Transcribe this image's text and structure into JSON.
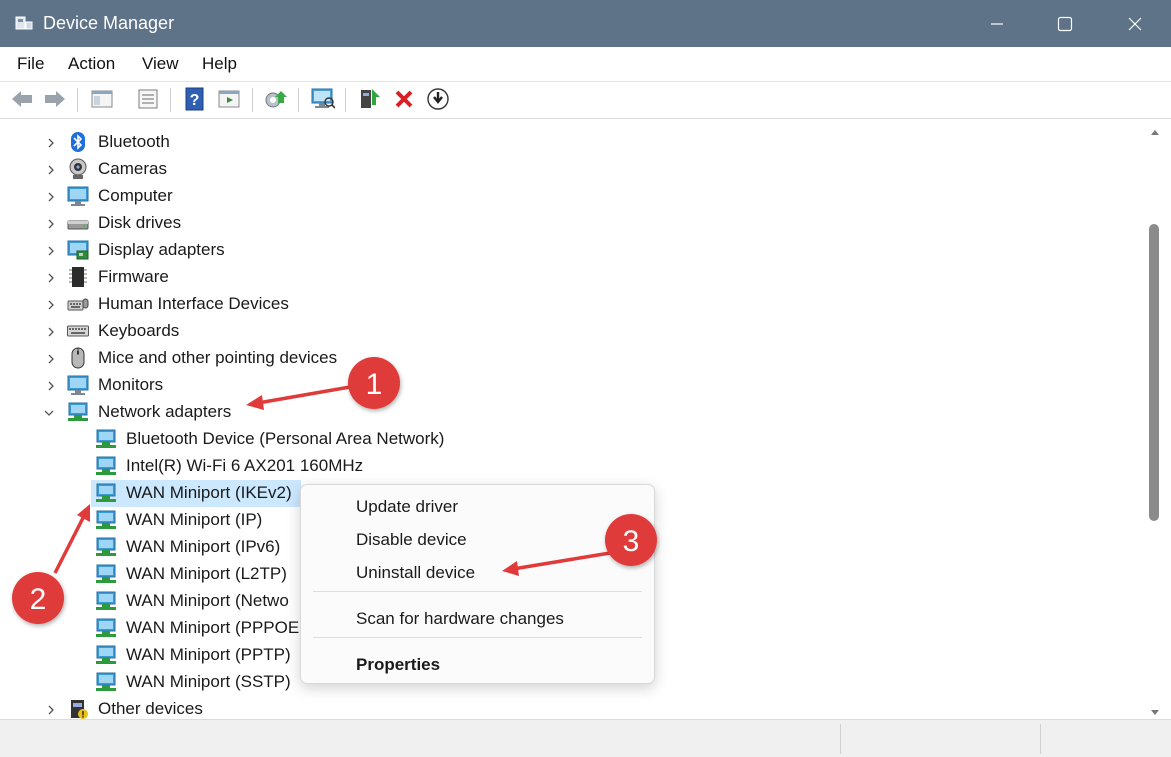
{
  "window": {
    "title": "Device Manager"
  },
  "menu": [
    "File",
    "Action",
    "View",
    "Help"
  ],
  "toolbar": {
    "buttons": [
      "back-icon",
      "forward-icon",
      "show-hide-console-tree-icon",
      "properties-icon",
      "help-icon",
      "action-pane-icon",
      "update-driver-icon",
      "scan-hardware-icon",
      "enable-device-icon",
      "uninstall-device-icon",
      "disable-device-icon"
    ]
  },
  "tree": {
    "categories": [
      {
        "label": "Bluetooth",
        "icon": "bluetooth-icon"
      },
      {
        "label": "Cameras",
        "icon": "camera-icon"
      },
      {
        "label": "Computer",
        "icon": "computer-icon"
      },
      {
        "label": "Disk drives",
        "icon": "disk-drive-icon"
      },
      {
        "label": "Display adapters",
        "icon": "display-adapter-icon"
      },
      {
        "label": "Firmware",
        "icon": "firmware-icon"
      },
      {
        "label": "Human Interface Devices",
        "icon": "hid-icon"
      },
      {
        "label": "Keyboards",
        "icon": "keyboard-icon"
      },
      {
        "label": "Mice and other pointing devices",
        "icon": "mouse-icon"
      },
      {
        "label": "Monitors",
        "icon": "monitor-icon"
      },
      {
        "label": "Network adapters",
        "icon": "network-adapter-icon",
        "expanded": true
      },
      {
        "label": "Other devices",
        "icon": "other-devices-icon"
      }
    ],
    "network_children": [
      "Bluetooth Device (Personal Area Network)",
      "Intel(R) Wi-Fi 6 AX201 160MHz",
      "WAN Miniport (IKEv2)",
      "WAN Miniport (IP)",
      "WAN Miniport (IPv6)",
      "WAN Miniport (L2TP)",
      "WAN Miniport (Netwo",
      "WAN Miniport (PPPOE",
      "WAN Miniport (PPTP)",
      "WAN Miniport (SSTP)"
    ],
    "selected": "WAN Miniport (IKEv2)"
  },
  "context_menu": {
    "items": [
      "Update driver",
      "Disable device",
      "Uninstall device",
      "Scan for hardware changes",
      "Properties"
    ]
  },
  "annotations": [
    "1",
    "2",
    "3"
  ],
  "colors": {
    "titlebar": "#5e7388",
    "selection": "#cce8ff",
    "annotation": "#e03a3a"
  }
}
